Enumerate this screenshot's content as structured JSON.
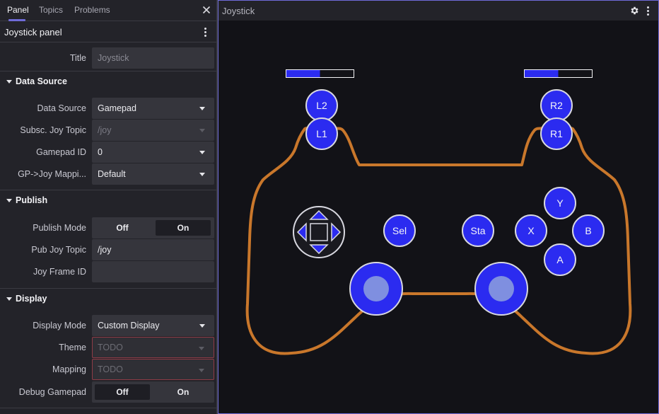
{
  "tabs": [
    {
      "label": "Panel"
    },
    {
      "label": "Topics"
    },
    {
      "label": "Problems"
    }
  ],
  "panel": {
    "title": "Joystick panel"
  },
  "fields": {
    "title": {
      "label": "Title",
      "value": "Joystick"
    }
  },
  "sections": {
    "data_source": {
      "title": "Data Source",
      "rows": [
        {
          "label": "Data Source",
          "value": "Gamepad"
        },
        {
          "label": "Subsc. Joy Topic",
          "value": "/joy"
        },
        {
          "label": "Gamepad ID",
          "value": "0"
        },
        {
          "label": "GP->Joy Mappi...",
          "value": "Default"
        }
      ]
    },
    "publish": {
      "title": "Publish",
      "mode": {
        "label": "Publish Mode",
        "off": "Off",
        "on": "On",
        "selected": "On"
      },
      "topic": {
        "label": "Pub Joy Topic",
        "value": "/joy"
      },
      "frame": {
        "label": "Joy Frame ID",
        "value": ""
      }
    },
    "display": {
      "title": "Display",
      "mode": {
        "label": "Display Mode",
        "value": "Custom Display"
      },
      "theme": {
        "label": "Theme",
        "value": "TODO"
      },
      "mapping": {
        "label": "Mapping",
        "value": "TODO"
      },
      "debug": {
        "label": "Debug Gamepad",
        "off": "Off",
        "on": "On",
        "selected": "Off"
      }
    }
  },
  "viewer": {
    "title": "Joystick",
    "trigger_left_level": 0.5,
    "trigger_right_level": 0.5,
    "buttons": {
      "l2": "L2",
      "l1": "L1",
      "r2": "R2",
      "r1": "R1",
      "select": "Sel",
      "start": "Sta",
      "y": "Y",
      "x": "X",
      "b": "B",
      "a": "A"
    }
  },
  "colors": {
    "accent": "#6f6bd8",
    "button_fill": "#2b2bf0",
    "stick_inner": "#7f8fe0",
    "controller_outline": "#c9772b",
    "todo_border": "#8e3b46"
  }
}
